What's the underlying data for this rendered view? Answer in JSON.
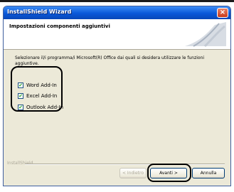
{
  "window": {
    "title": "InstallShield Wizard",
    "close_glyph": "×"
  },
  "header": {
    "title": "Impostazioni componenti aggiuntivi"
  },
  "body": {
    "description": "Selezionare il/i programma/i Microsoft(R) Office dai quali si desidera utilizzare le funzioni aggiuntive.",
    "checkboxes": [
      {
        "label": "Word Add-In",
        "checked": true
      },
      {
        "label": "Excel Add-In",
        "checked": true
      },
      {
        "label": "Outlook Add-In",
        "checked": true
      }
    ]
  },
  "footer": {
    "brand": "InstallShield"
  },
  "buttons": {
    "back": "< Indietro",
    "next": "Avanti >",
    "cancel": "Annulla"
  },
  "colors": {
    "titlebar": "#0a58d8",
    "dialog_bg": "#ece9d8",
    "highlight": "#000000"
  }
}
